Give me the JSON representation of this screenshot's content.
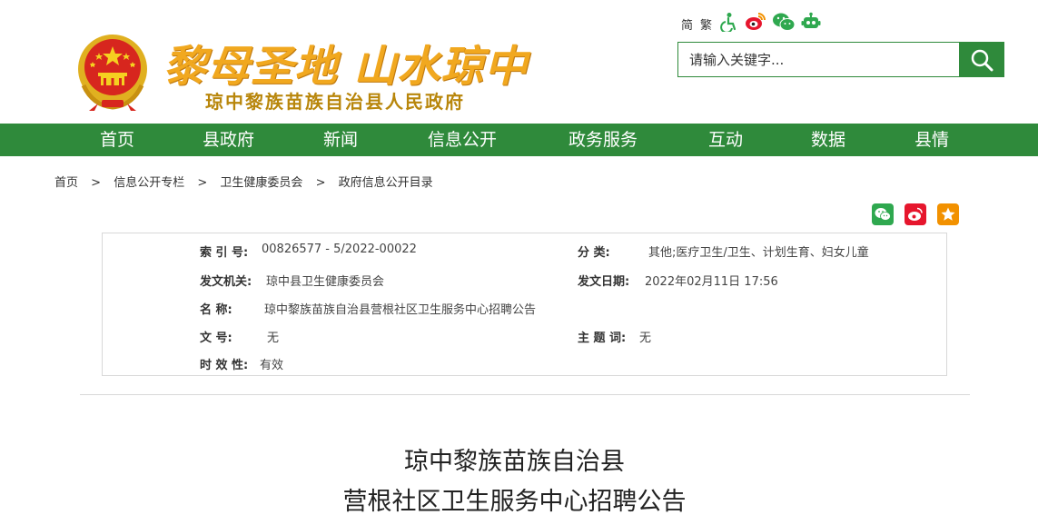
{
  "header": {
    "slogan": "黎母圣地 山水琼中",
    "subtitle": "琼中黎族苗族自治县人民政府"
  },
  "tools": {
    "simplified": "简",
    "traditional": "繁"
  },
  "search": {
    "placeholder": "请输入关键字..."
  },
  "nav": {
    "items": [
      "首页",
      "县政府",
      "新闻",
      "信息公开",
      "政务服务",
      "互动",
      "数据",
      "县情"
    ]
  },
  "breadcrumb": {
    "items": [
      "首页",
      "信息公开专栏",
      "卫生健康委员会",
      "政府信息公开目录"
    ],
    "separator": ">"
  },
  "meta": {
    "index_label": "索 引 号:",
    "index_value": "00826577 - 5/2022-00022",
    "category_label": "分      类:",
    "category_value": "其他;医疗卫生/卫生、计划生育、妇女儿童",
    "issuer_label": "发文机关:",
    "issuer_value": "琼中县卫生健康委员会",
    "date_label": "发文日期:",
    "date_value": "2022年02月11日 17:56",
    "name_label": "名      称:",
    "name_value": "琼中黎族苗族自治县营根社区卫生服务中心招聘公告",
    "docno_label": "文      号:",
    "docno_value": "无",
    "keyword_label": "主 题 词:",
    "keyword_value": "无",
    "validity_label": "时 效 性:",
    "validity_value": "有效"
  },
  "article": {
    "title_line1": "琼中黎族苗族自治县",
    "title_line2": "营根社区卫生服务中心招聘公告"
  },
  "colors": {
    "nav_green": "#2f8a3b",
    "slogan_gold": "#f1a81f",
    "emblem_red": "#d7261e"
  }
}
